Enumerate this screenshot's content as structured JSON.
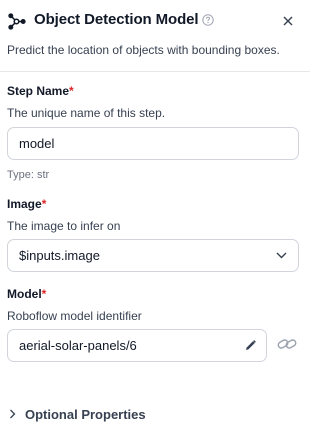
{
  "header": {
    "title": "Object Detection Model",
    "subtitle": "Predict the location of objects with bounding boxes.",
    "block_icon": "graph-nodes-icon",
    "help_icon": "question-circle-icon",
    "close_icon": "close-icon"
  },
  "fields": {
    "step_name": {
      "label": "Step Name",
      "required_mark": "*",
      "description": "The unique name of this step.",
      "value": "model",
      "type_hint": "Type: str"
    },
    "image": {
      "label": "Image",
      "required_mark": "*",
      "description": "The image to infer on",
      "value": "$inputs.image",
      "icon": "chevron-down-icon"
    },
    "model": {
      "label": "Model",
      "required_mark": "*",
      "description": "Roboflow model identifier",
      "value": "aerial-solar-panels/6",
      "edit_icon": "pencil-icon",
      "link_icon": "link-icon"
    }
  },
  "optional_properties": {
    "label": "Optional Properties",
    "icon": "chevron-right-icon"
  },
  "colors": {
    "required": "#dc2626",
    "border": "#d1d5db",
    "text": "#111827",
    "muted": "#6b7280"
  }
}
